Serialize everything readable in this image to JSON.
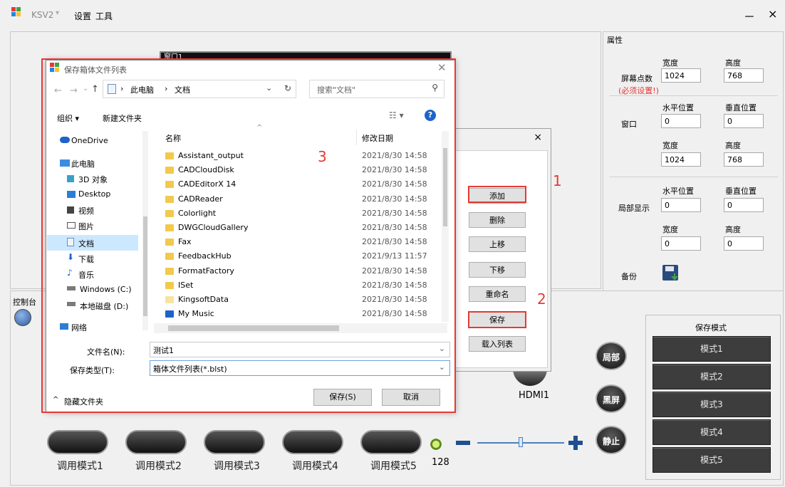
{
  "titlebar": {
    "app_name": "KSV2",
    "menu_settings": "设置",
    "menu_tools": "工具",
    "minimize": "－",
    "close": "×"
  },
  "bg_window_label": "窗口1",
  "properties": {
    "title": "属性",
    "width_header": "宽度",
    "height_header": "高度",
    "screen_points_label": "屏幕点数",
    "screen_width": "1024",
    "screen_height": "768",
    "required_note": "(必须设置!)",
    "h_pos_header": "水平位置",
    "v_pos_header": "垂直位置",
    "window_label": "窗口",
    "window_x": "0",
    "window_y": "0",
    "window_width": "1024",
    "window_height": "768",
    "local_label": "局部显示",
    "local_x": "0",
    "local_y": "0",
    "local_width": "0",
    "local_height": "0",
    "backup_label": "备份"
  },
  "console_label": "控制台",
  "save_mode": {
    "title": "保存模式",
    "modes": [
      "模式1",
      "模式2",
      "模式3",
      "模式4",
      "模式5"
    ]
  },
  "round_buttons": {
    "local": "局部",
    "black": "黑屏",
    "freeze": "静止"
  },
  "hdmi_label": "HDMI1",
  "brightness_value": "128",
  "call_modes": [
    "调用模式1",
    "调用模式2",
    "调用模式3",
    "调用模式4",
    "调用模式5"
  ],
  "second_dialog": {
    "close": "×",
    "buttons": {
      "add": "添加",
      "delete": "删除",
      "up": "上移",
      "down": "下移",
      "rename": "重命名",
      "save": "保存",
      "load": "载入列表"
    }
  },
  "annotations": {
    "one": "1",
    "two": "2",
    "three": "3"
  },
  "dialog": {
    "title": "保存箱体文件列表",
    "path": {
      "pc": "此电脑",
      "docs": "文档"
    },
    "search_placeholder": "搜索\"文档\"",
    "organize": "组织 ▾",
    "new_folder": "新建文件夹",
    "col_name": "名称",
    "col_date": "修改日期",
    "nav": [
      "OneDrive",
      "此电脑",
      "3D 对象",
      "Desktop",
      "视频",
      "图片",
      "文档",
      "下载",
      "音乐",
      "Windows (C:)",
      "本地磁盘 (D:)",
      "网络"
    ],
    "files": [
      {
        "name": "Assistant_output",
        "date": "2021/8/30 14:58"
      },
      {
        "name": "CADCloudDisk",
        "date": "2021/8/30 14:58"
      },
      {
        "name": "CADEditorX 14",
        "date": "2021/8/30 14:58"
      },
      {
        "name": "CADReader",
        "date": "2021/8/30 14:58"
      },
      {
        "name": "Colorlight",
        "date": "2021/8/30 14:58"
      },
      {
        "name": "DWGCloudGallery",
        "date": "2021/8/30 14:58"
      },
      {
        "name": "Fax",
        "date": "2021/8/30 14:58"
      },
      {
        "name": "FeedbackHub",
        "date": "2021/9/13 11:57"
      },
      {
        "name": "FormatFactory",
        "date": "2021/8/30 14:58"
      },
      {
        "name": "ISet",
        "date": "2021/8/30 14:58"
      },
      {
        "name": "KingsoftData",
        "date": "2021/8/30 14:58"
      },
      {
        "name": "My Music",
        "date": "2021/8/30 14:58"
      }
    ],
    "filename_label": "文件名(N):",
    "filename_value": "测试1",
    "filetype_label": "保存类型(T):",
    "filetype_value": "箱体文件列表(*.blst)",
    "hide_folders": "隐藏文件夹",
    "save_btn": "保存(S)",
    "cancel_btn": "取消"
  },
  "colors": {
    "accent_red": "#e53935",
    "mode_btn": "#3d3d3d",
    "selection": "#cce8ff"
  }
}
